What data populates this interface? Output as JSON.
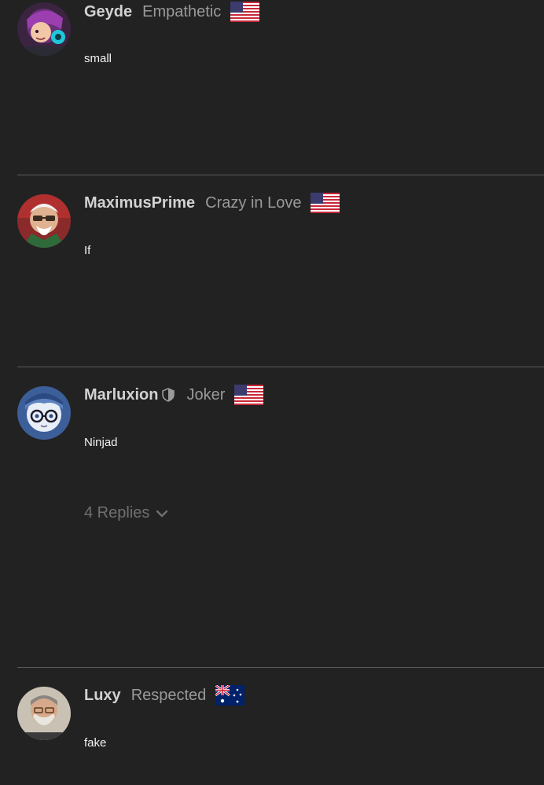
{
  "comments": [
    {
      "username": "Geyde",
      "rank": "Empathetic",
      "flag": "us-flag-icon",
      "text": "small",
      "avatar": "purple-cartoon-avatar"
    },
    {
      "username": "MaximusPrime",
      "rank": "Crazy in Love",
      "flag": "us-flag-icon",
      "text": "If",
      "avatar": "elderly-man-sunglasses-avatar"
    },
    {
      "username": "Marluxion",
      "rank": "Joker",
      "flag": "us-flag-icon",
      "text": "Ninjad",
      "avatar": "blue-anime-glasses-avatar",
      "badge": "shield-icon",
      "replies": {
        "label": "4 Replies",
        "icon": "chevron-down-icon"
      }
    },
    {
      "username": "Luxy",
      "rank": "Respected",
      "flag": "au-flag-icon",
      "text": "fake",
      "avatar": "bearded-man-avatar"
    }
  ],
  "colors": {
    "background": "#222222",
    "username": "#d2d2d2",
    "rank": "#9a9a9a",
    "divider": "#5a5a5a",
    "replies": "#707070"
  }
}
